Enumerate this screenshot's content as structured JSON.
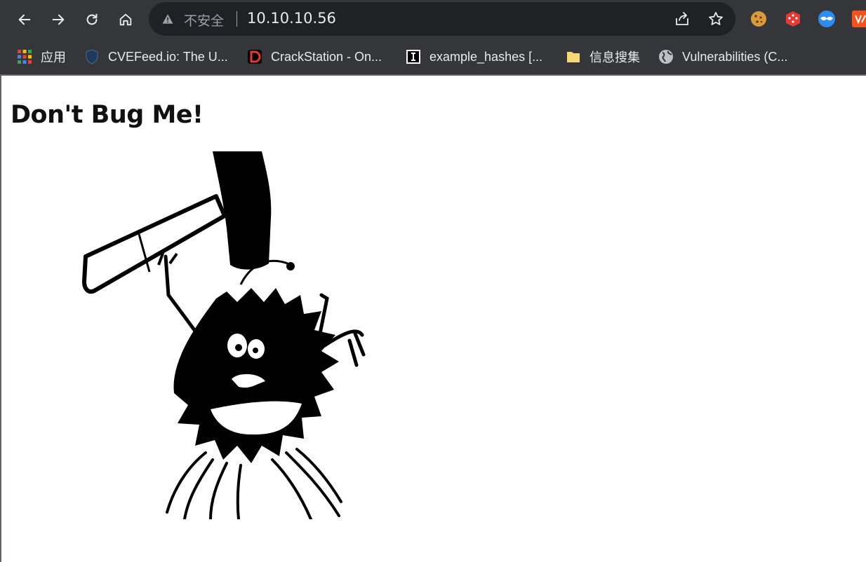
{
  "browser": {
    "security_label": "不安全",
    "url": "10.10.10.56",
    "bookmarks": [
      {
        "label": "应用",
        "icon": "apps-grid-icon"
      },
      {
        "label": "CVEFeed.io: The U...",
        "icon": "cvefeed-shield-icon"
      },
      {
        "label": "CrackStation - On...",
        "icon": "crackstation-d-icon"
      },
      {
        "label": "example_hashes [...",
        "icon": "hashcat-icon"
      },
      {
        "label": "信息搜集",
        "icon": "folder-icon"
      },
      {
        "label": "Vulnerabilities (C...",
        "icon": "globe-icon"
      }
    ],
    "extensions": [
      "cookie-extension-icon",
      "red-dice-extension-icon",
      "blue-mask-extension-icon",
      "orange-extension-icon"
    ]
  },
  "page": {
    "heading": "Don't Bug Me!",
    "image": "hammer-over-bug-cartoon"
  },
  "colors": {
    "chrome_dark": "#35363a",
    "omnibox": "#202124",
    "text_light": "#e8eaed",
    "text_muted": "#9aa0a6"
  }
}
